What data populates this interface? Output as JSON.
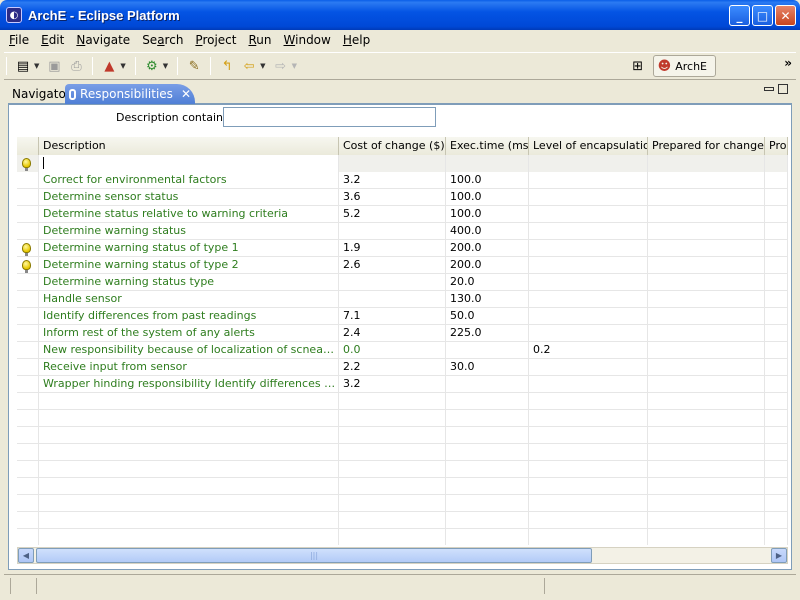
{
  "window": {
    "title": "ArchE - Eclipse Platform",
    "icon": "eclipse-icon"
  },
  "menu": [
    "File",
    "Edit",
    "Navigate",
    "Search",
    "Project",
    "Run",
    "Window",
    "Help"
  ],
  "toolbar": {
    "icons": [
      "new-icon",
      "save-icon",
      "print-icon",
      "arche-icon",
      "run-icon",
      "plugin-icon",
      "back-icon",
      "forward-icon"
    ],
    "perspective_label": "ArchE"
  },
  "tabs": [
    {
      "label": "Navigator",
      "active": false
    },
    {
      "label": "Responsibilities",
      "active": true
    }
  ],
  "filter": {
    "label": "Description contains:",
    "value": ""
  },
  "table": {
    "columns": [
      "",
      "Description",
      "Cost of change ($)",
      "Exec.time (ms)",
      "Level of encapsulation",
      "Prepared for change?",
      "Pro"
    ],
    "rows": [
      {
        "icon": "",
        "description": "Correct for environmental factors",
        "cost": "3.2",
        "exec": "100.0",
        "level": "",
        "prepared": ""
      },
      {
        "icon": "",
        "description": "Determine sensor status",
        "cost": "3.6",
        "exec": "100.0",
        "level": "",
        "prepared": ""
      },
      {
        "icon": "",
        "description": "Determine status relative to warning criteria",
        "cost": "5.2",
        "exec": "100.0",
        "level": "",
        "prepared": ""
      },
      {
        "icon": "",
        "description": "Determine warning status",
        "cost": "",
        "exec": "400.0",
        "level": "",
        "prepared": ""
      },
      {
        "icon": "bulb",
        "description": "Determine warning status of type 1",
        "cost": "1.9",
        "exec": "200.0",
        "level": "",
        "prepared": ""
      },
      {
        "icon": "bulb",
        "description": "Determine warning status of type 2",
        "cost": "2.6",
        "exec": "200.0",
        "level": "",
        "prepared": ""
      },
      {
        "icon": "",
        "description": "Determine warning status type",
        "cost": "",
        "exec": "20.0",
        "level": "",
        "prepared": ""
      },
      {
        "icon": "",
        "description": "Handle sensor",
        "cost": "",
        "exec": "130.0",
        "level": "",
        "prepared": ""
      },
      {
        "icon": "",
        "description": "Identify differences from past readings",
        "cost": "7.1",
        "exec": "50.0",
        "level": "",
        "prepared": ""
      },
      {
        "icon": "",
        "description": "Inform rest of the system of any alerts",
        "cost": "2.4",
        "exec": "225.0",
        "level": "",
        "prepared": ""
      },
      {
        "icon": "",
        "description": "New responsibility because of localization of scneario gen...",
        "cost": "0.0",
        "cost_green": true,
        "exec": "",
        "level": "0.2",
        "prepared": ""
      },
      {
        "icon": "",
        "description": "Receive input from sensor",
        "cost": "2.2",
        "exec": "30.0",
        "level": "",
        "prepared": ""
      },
      {
        "icon": "",
        "description": "Wrapper hinding responsibility Identify differences from p...",
        "cost": "3.2",
        "exec": "",
        "level": "",
        "prepared": ""
      }
    ],
    "empty_rows": 9,
    "accent": "#2e7d1e"
  }
}
